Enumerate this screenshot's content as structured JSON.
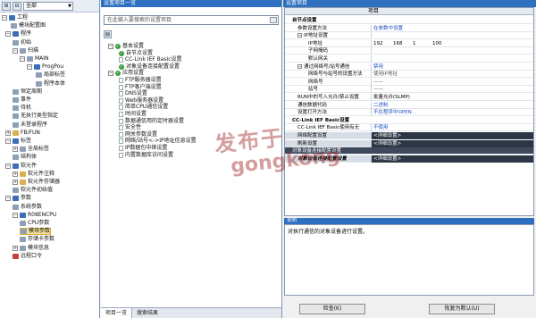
{
  "nav": {
    "filter_value": "全部",
    "items": [
      {
        "label": "工程",
        "exp": "−"
      },
      {
        "label": "模块配置图",
        "exp": ""
      },
      {
        "label": "程序",
        "exp": "−"
      },
      {
        "label": "初始",
        "exp": ""
      },
      {
        "label": "扫描",
        "exp": "−"
      },
      {
        "label": "MAIN",
        "exp": "−"
      },
      {
        "label": "ProgPou",
        "exp": "−"
      },
      {
        "label": "局部标签",
        "exp": ""
      },
      {
        "label": "程序本体",
        "exp": ""
      },
      {
        "label": "恒定周期",
        "exp": ""
      },
      {
        "label": "事件",
        "exp": ""
      },
      {
        "label": "待机",
        "exp": ""
      },
      {
        "label": "无执行类型指定",
        "exp": ""
      },
      {
        "label": "未登录程序",
        "exp": ""
      },
      {
        "label": "FB/FUN",
        "exp": "+"
      },
      {
        "label": "标签",
        "exp": "−"
      },
      {
        "label": "全局标签",
        "exp": "+"
      },
      {
        "label": "结构体",
        "exp": ""
      },
      {
        "label": "软元件",
        "exp": "−"
      },
      {
        "label": "软元件注释",
        "exp": "+"
      },
      {
        "label": "软元件存储器",
        "exp": "+"
      },
      {
        "label": "软元件初始值",
        "exp": ""
      },
      {
        "label": "参数",
        "exp": "−"
      },
      {
        "label": "系统参数",
        "exp": ""
      },
      {
        "label": "R08ENCPU",
        "exp": "−"
      },
      {
        "label": "CPU参数",
        "exp": ""
      },
      {
        "label": "模块参数",
        "exp": ""
      },
      {
        "label": "存储卡参数",
        "exp": ""
      },
      {
        "label": "模块信息",
        "exp": "+"
      },
      {
        "label": "远程口令",
        "exp": ""
      }
    ]
  },
  "mid": {
    "title": "设置项目一览",
    "search_placeholder": "在此输入要搜索的设置项目",
    "items": [
      {
        "label": "基本设置",
        "kind": "folder"
      },
      {
        "label": "自节点设置",
        "kind": "check"
      },
      {
        "label": "CC-Link IEF Basic设置",
        "kind": "doc"
      },
      {
        "label": "对象设备连接配置设置",
        "kind": "check"
      },
      {
        "label": "应用设置",
        "kind": "folder"
      },
      {
        "label": "FTP服务器设置",
        "kind": "doc"
      },
      {
        "label": "FTP客户端设置",
        "kind": "doc"
      },
      {
        "label": "DNS设置",
        "kind": "doc"
      },
      {
        "label": "Web服务器设置",
        "kind": "doc"
      },
      {
        "label": "简单CPU通信设置",
        "kind": "doc"
      },
      {
        "label": "时间设置",
        "kind": "doc"
      },
      {
        "label": "数据通信用的定时器设置",
        "kind": "doc"
      },
      {
        "label": "安全性",
        "kind": "doc"
      },
      {
        "label": "网关参数设置",
        "kind": "doc"
      },
      {
        "label": "网络/站号<->IP地址信息设置",
        "kind": "doc"
      },
      {
        "label": "IP数据包中继设置",
        "kind": "doc"
      },
      {
        "label": "内置数据库访问设置",
        "kind": "doc"
      }
    ],
    "tabs": [
      "项目一览",
      "搜索结果"
    ]
  },
  "right": {
    "title": "设置项目",
    "column_header": "项目",
    "rows": [
      {
        "key": "自节点设置",
        "value": "",
        "style": "sec",
        "indent": 1
      },
      {
        "key": "参数设置方法",
        "value": "在参数中设置",
        "style": "blue",
        "indent": 2
      },
      {
        "key": "IP地址设置",
        "value": "",
        "style": "plain",
        "indent": 2,
        "exp": "−"
      },
      {
        "key": "IP地址",
        "value": "",
        "ip": [
          "192",
          "168",
          "1",
          "100"
        ],
        "style": "plain",
        "indent": 3
      },
      {
        "key": "子网掩码",
        "value": "",
        "style": "plain",
        "indent": 3
      },
      {
        "key": "默认网关",
        "value": "",
        "style": "plain",
        "indent": 3
      },
      {
        "key": "通过网络号/站号通信",
        "value": "禁用",
        "style": "blue",
        "indent": 2,
        "exp": "−"
      },
      {
        "key": "网络号与站号的设置方法",
        "value": "使用IP地址",
        "style": "gray",
        "indent": 3
      },
      {
        "key": "网络号",
        "value": "——",
        "style": "gray",
        "indent": 3
      },
      {
        "key": "站号",
        "value": "——",
        "style": "gray",
        "indent": 3
      },
      {
        "key": "RUN中的写入允许/禁止设置",
        "value": "批量允许(SLMP)",
        "style": "plain",
        "indent": 2
      },
      {
        "key": "通信数据代码",
        "value": "二进制",
        "style": "blue",
        "indent": 2
      },
      {
        "key": "设置打开方法",
        "value": "不在程序中OPEN",
        "style": "blue",
        "indent": 2
      },
      {
        "key": "CC-Link IEF Basic设置",
        "value": "",
        "style": "sec",
        "indent": 1
      },
      {
        "key": "CC-Link IEF Basic使用有无",
        "value": "不使用",
        "style": "blue",
        "indent": 2
      },
      {
        "key": "网络配置设置",
        "value": "<详细设置>",
        "style": "darkv",
        "indent": 2
      },
      {
        "key": "刷新设置",
        "value": "<详细设置>",
        "style": "darkv",
        "indent": 2
      },
      {
        "key": "对象设备连接配置设置",
        "value": "",
        "style": "dark",
        "indent": 1
      },
      {
        "key": "对象设备连接配置设置",
        "value": "<详细设置>",
        "style": "darkv2",
        "indent": 2
      }
    ],
    "explain_title": "说明",
    "explain_text": "对执行通信的对象设备进行设置。",
    "check_button": "检查(K)",
    "default_button": "恢复为默认(U)"
  },
  "watermark": {
    "line1": "发布于",
    "line2": "gongkong"
  }
}
